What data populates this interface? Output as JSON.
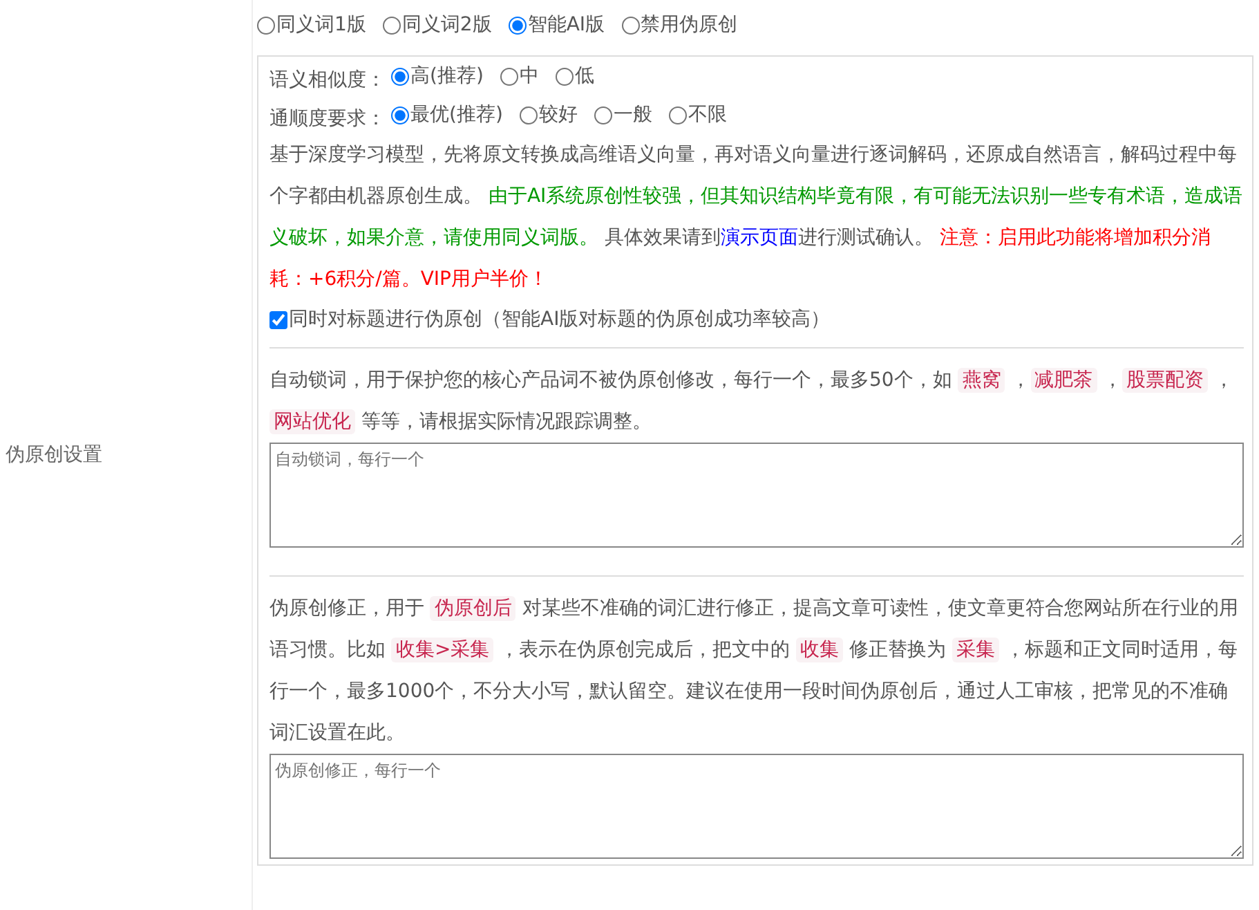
{
  "label": "伪原创设置",
  "modes": [
    {
      "label": "同义词1版",
      "selected": false
    },
    {
      "label": "同义词2版",
      "selected": false
    },
    {
      "label": "智能AI版",
      "selected": true
    },
    {
      "label": "禁用伪原创",
      "selected": false
    }
  ],
  "similarity": {
    "label": "语义相似度：",
    "options": [
      {
        "label": "高(推荐)",
        "selected": true
      },
      {
        "label": "中",
        "selected": false
      },
      {
        "label": "低",
        "selected": false
      }
    ]
  },
  "fluency": {
    "label": "通顺度要求：",
    "options": [
      {
        "label": "最优(推荐)",
        "selected": true
      },
      {
        "label": "较好",
        "selected": false
      },
      {
        "label": "一般",
        "selected": false
      },
      {
        "label": "不限",
        "selected": false
      }
    ]
  },
  "description": [
    {
      "kind": "text",
      "text": "基于深度学习模型，先将原文转换成高维语义向量，再对语义向量进行逐词解码，还原成自然语言，解码过程中每个字都由机器原创生成。 "
    },
    {
      "kind": "note",
      "text": "由于AI系统原创性较强，但其知识结构毕竟有限，有可能无法识别一些专有术语，造成语义破坏，如果介意，请使用同义词版。"
    },
    {
      "kind": "text",
      "text": " 具体效果请到"
    },
    {
      "kind": "link",
      "text": "演示页面"
    },
    {
      "kind": "text",
      "text": "进行测试确认。 "
    },
    {
      "kind": "warning",
      "text": "注意：启用此功能将增加积分消耗：+6积分/篇。VIP用户半价！"
    }
  ],
  "title_option": {
    "label": "同时对标题进行伪原创（智能AI版对标题的伪原创成功率较高）",
    "checked": true
  },
  "lock_words": {
    "description": [
      {
        "kind": "text",
        "text": "自动锁词，用于保护您的核心产品词不被伪原创修改，每行一个，最多50个，如 "
      },
      {
        "kind": "code",
        "text": "燕窝"
      },
      {
        "kind": "text",
        "text": " ，"
      },
      {
        "kind": "code",
        "text": "减肥茶"
      },
      {
        "kind": "text",
        "text": " ，"
      },
      {
        "kind": "code",
        "text": "股票配资"
      },
      {
        "kind": "text",
        "text": " ，"
      },
      {
        "kind": "code",
        "text": "网站优化"
      },
      {
        "kind": "text",
        "text": " 等等，请根据实际情况跟踪调整。"
      }
    ],
    "placeholder": "自动锁词，每行一个"
  },
  "corrections": {
    "description": [
      {
        "kind": "text",
        "text": "伪原创修正，用于 "
      },
      {
        "kind": "code",
        "text": "伪原创后"
      },
      {
        "kind": "text",
        "text": " 对某些不准确的词汇进行修正，提高文章可读性，使文章更符合您网站所在行业的用语习惯。比如 "
      },
      {
        "kind": "code",
        "text": "收集>采集"
      },
      {
        "kind": "text",
        "text": " ，表示在伪原创完成后，把文中的 "
      },
      {
        "kind": "code",
        "text": "收集"
      },
      {
        "kind": "text",
        "text": " 修正替换为 "
      },
      {
        "kind": "code",
        "text": "采集"
      },
      {
        "kind": "text",
        "text": " ，标题和正文同时适用，每行一个，最多1000个，不分大小写，默认留空。建议在使用一段时间伪原创后，通过人工审核，把常见的不准确词汇设置在此。"
      }
    ],
    "placeholder": "伪原创修正，每行一个"
  }
}
